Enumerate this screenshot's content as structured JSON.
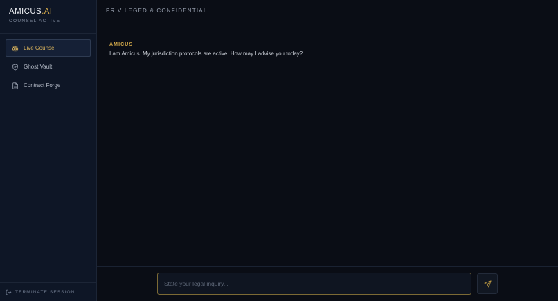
{
  "brand": {
    "name": "AMICUS",
    "suffix": ".AI",
    "status": "COUNSEL ACTIVE"
  },
  "nav": {
    "items": [
      {
        "label": "Live Counsel",
        "icon": "scale-icon",
        "active": true
      },
      {
        "label": "Ghost Vault",
        "icon": "shield-icon",
        "active": false
      },
      {
        "label": "Contract Forge",
        "icon": "document-icon",
        "active": false
      }
    ]
  },
  "sidebar_footer": {
    "label": "TERMINATE SESSION",
    "icon": "logout-icon"
  },
  "header": {
    "title": "PRIVILEGED & CONFIDENTIAL"
  },
  "chat": {
    "messages": [
      {
        "author": "AMICUS",
        "text": "I am Amicus. My jurisdiction protocols are active. How may I advise you today?"
      }
    ]
  },
  "composer": {
    "value": "",
    "placeholder": "State your legal inquiry...",
    "send_icon": "send-icon"
  },
  "colors": {
    "accent": "#d2a84a",
    "sidebar_bg": "#0e1626",
    "main_bg": "#0a0d15"
  }
}
